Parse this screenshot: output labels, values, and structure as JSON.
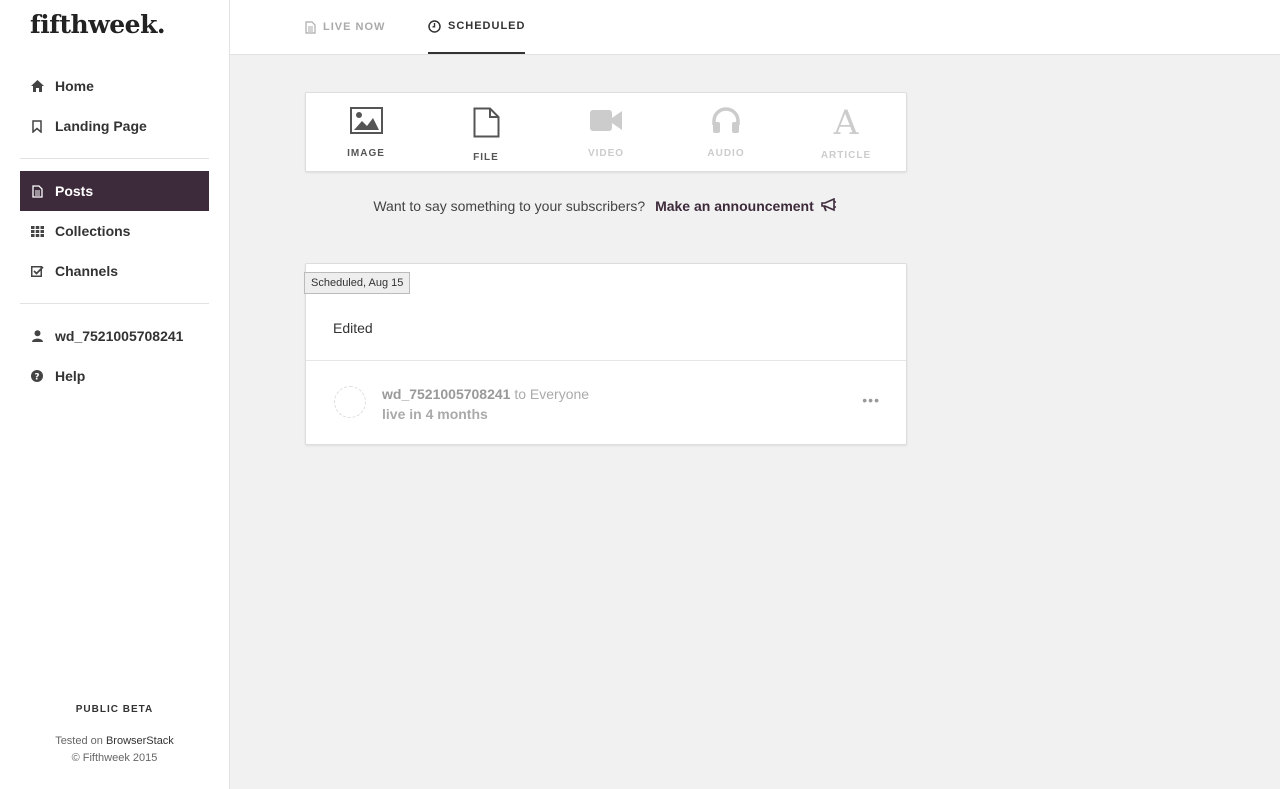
{
  "brand": {
    "logo": "fifthweek."
  },
  "sidebar": {
    "items": [
      {
        "label": "Home",
        "icon": "home-icon"
      },
      {
        "label": "Landing Page",
        "icon": "bookmark-icon"
      },
      {
        "label": "Posts",
        "icon": "file-icon",
        "active": true
      },
      {
        "label": "Collections",
        "icon": "grid-icon"
      },
      {
        "label": "Channels",
        "icon": "check-square-icon"
      },
      {
        "label": "wd_7521005708241",
        "icon": "user-icon"
      },
      {
        "label": "Help",
        "icon": "question-circle-icon"
      }
    ],
    "footer": {
      "beta": "PUBLIC BETA",
      "tested_prefix": "Tested on",
      "tested_link": "BrowserStack",
      "copyright": "© Fifthweek 2015"
    }
  },
  "tabs": [
    {
      "label": "LIVE NOW",
      "icon": "file-icon"
    },
    {
      "label": "SCHEDULED",
      "icon": "clock-icon",
      "active": true
    }
  ],
  "composer": {
    "types": [
      {
        "label": "IMAGE",
        "icon": "image-icon",
        "enabled": true
      },
      {
        "label": "FILE",
        "icon": "file-outline-icon",
        "enabled": true
      },
      {
        "label": "VIDEO",
        "icon": "video-camera-icon",
        "enabled": false
      },
      {
        "label": "AUDIO",
        "icon": "headphones-icon",
        "enabled": false
      },
      {
        "label": "ARTICLE",
        "icon": "font-icon",
        "enabled": false
      }
    ]
  },
  "announcement": {
    "prompt": "Want to say something to your subscribers?",
    "cta": "Make an announcement"
  },
  "post": {
    "badge": "Scheduled, Aug 15",
    "text": "Edited",
    "author": "wd_7521005708241",
    "audience": "to Everyone",
    "status": "live in 4 months",
    "more": "•••"
  },
  "colors": {
    "accent": "#3d2a3a",
    "background": "#f1f1f1"
  }
}
